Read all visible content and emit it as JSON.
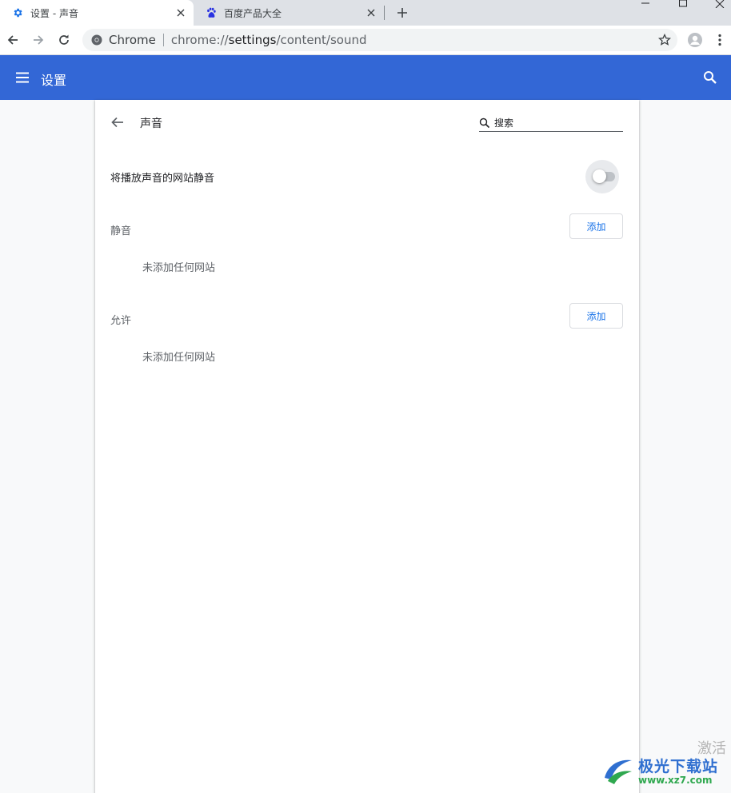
{
  "tabs": [
    {
      "title": "设置 - 声音",
      "icon": "gear-icon",
      "active": true
    },
    {
      "title": "百度产品大全",
      "icon": "baidu-paw-icon",
      "active": false
    }
  ],
  "omnibox": {
    "chip": "Chrome",
    "url_scheme": "chrome://",
    "url_host": "settings",
    "url_path": "/content/sound"
  },
  "header": {
    "title": "设置"
  },
  "subpage": {
    "title": "声音",
    "search_placeholder": "搜索",
    "mute_toggle_label": "将播放声音的网站静音",
    "mute_toggle_on": false,
    "sections": [
      {
        "label": "静音",
        "add_label": "添加",
        "empty_text": "未添加任何网站"
      },
      {
        "label": "允许",
        "add_label": "添加",
        "empty_text": "未添加任何网站"
      }
    ]
  },
  "watermark": {
    "activate": "激活",
    "brand": "极光下载站",
    "url": "www.xz7.com"
  },
  "colors": {
    "accent": "#3367d6",
    "link": "#1a73e8"
  }
}
